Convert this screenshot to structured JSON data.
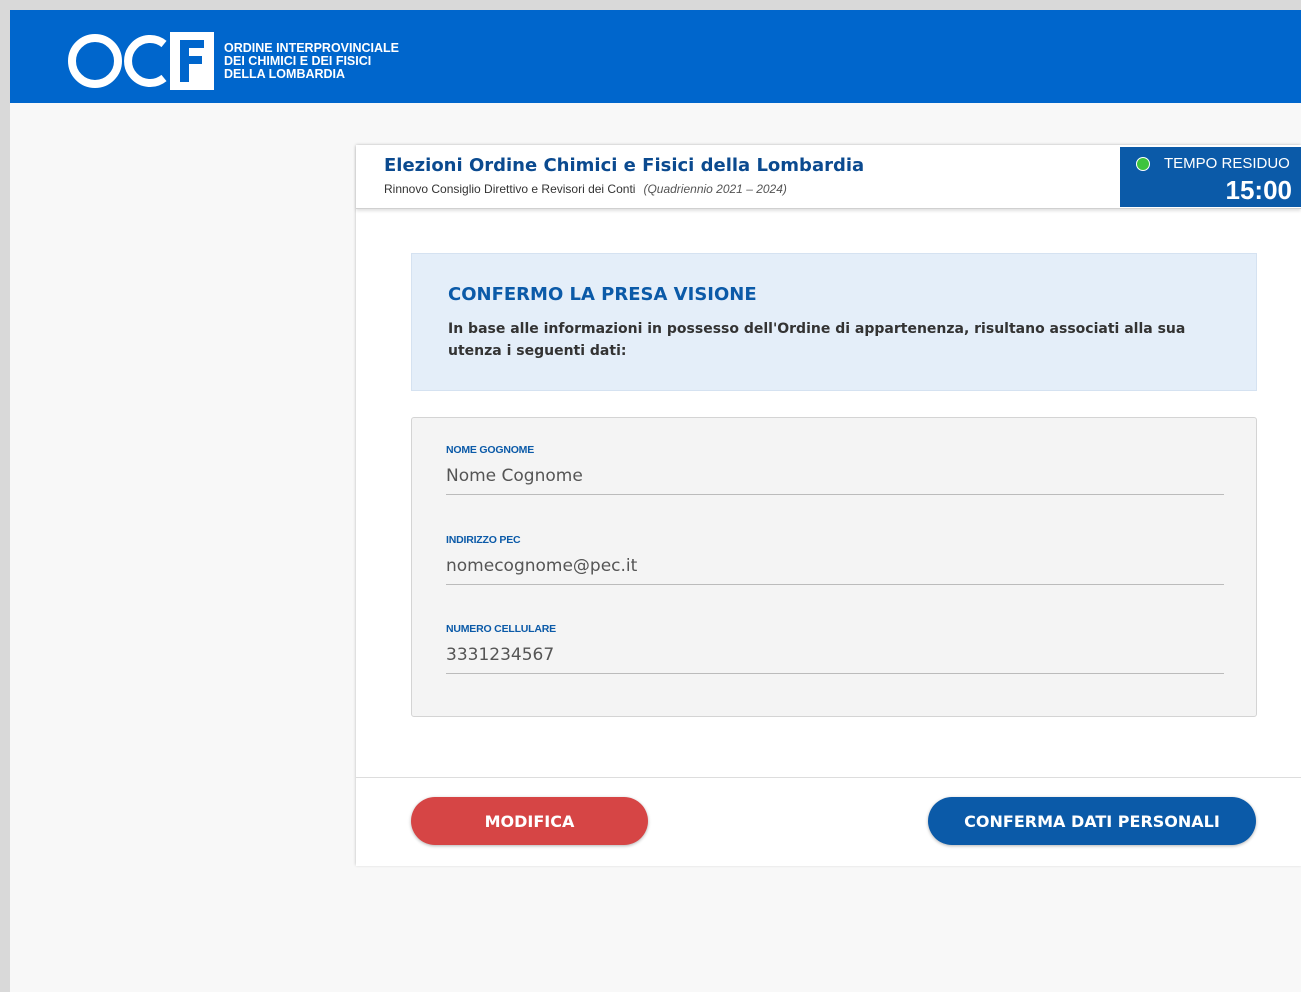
{
  "header": {
    "logo_letters": "OCF",
    "org_line1": "ORDINE INTERPROVINCIALE",
    "org_line2": "DEI CHIMICI E DEI FISICI",
    "org_line3": "DELLA LOMBARDIA"
  },
  "card": {
    "title": "Elezioni Ordine Chimici e Fisici della Lombardia",
    "subtitle": "Rinnovo Consiglio Direttivo e Revisori dei Conti",
    "period": "(Quadriennio 2021 – 2024)"
  },
  "timer": {
    "label": "TEMPO RESIDUO",
    "value": "15:00",
    "status_color": "#3ec43e"
  },
  "info": {
    "title": "CONFERMO LA PRESA VISIONE",
    "text": "In base alle informazioni in possesso dell'Ordine di appartenenza, risultano associati alla sua utenza i seguenti dati:"
  },
  "fields": [
    {
      "label": "NOME GOGNOME",
      "value": "Nome Cognome"
    },
    {
      "label": "INDIRIZZO PEC",
      "value": "nomecognome@pec.it"
    },
    {
      "label": "NUMERO CELLULARE",
      "value": "3331234567"
    }
  ],
  "actions": {
    "modify": "MODIFICA",
    "confirm": "CONFERMA DATI PERSONALI"
  },
  "colors": {
    "brand": "#0066cc",
    "accent": "#0b5aa8",
    "danger": "#d64545"
  }
}
